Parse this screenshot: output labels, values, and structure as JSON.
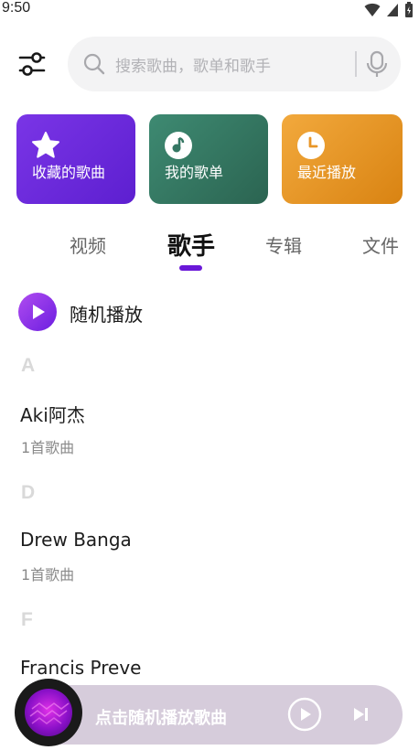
{
  "status": {
    "time": "9:50"
  },
  "search": {
    "placeholder": "搜索歌曲，歌单和歌手"
  },
  "cards": [
    {
      "label": "收藏的歌曲",
      "icon": "star-icon"
    },
    {
      "label": "我的歌单",
      "icon": "music-note-icon"
    },
    {
      "label": "最近播放",
      "icon": "clock-icon"
    }
  ],
  "tabs": [
    {
      "label": "视频",
      "active": false
    },
    {
      "label": "歌手",
      "active": true
    },
    {
      "label": "专辑",
      "active": false
    },
    {
      "label": "文件",
      "active": false
    }
  ],
  "shuffle": {
    "label": "随机播放"
  },
  "artists": {
    "sections": [
      {
        "letter": "A",
        "items": [
          {
            "name": "Aki阿杰",
            "count": "1首歌曲"
          }
        ]
      },
      {
        "letter": "D",
        "items": [
          {
            "name": "Drew Banga",
            "count": "1首歌曲"
          }
        ]
      },
      {
        "letter": "F",
        "items": [
          {
            "name": "Francis Preve",
            "count": ""
          }
        ]
      }
    ]
  },
  "player": {
    "hint": "点击随机播放歌曲"
  },
  "colors": {
    "accent": "#6a18d8",
    "fav_card": "#6b2ae0",
    "list_card": "#357763",
    "recent_card": "#e89628",
    "player_bg": "#d6ccdb"
  }
}
